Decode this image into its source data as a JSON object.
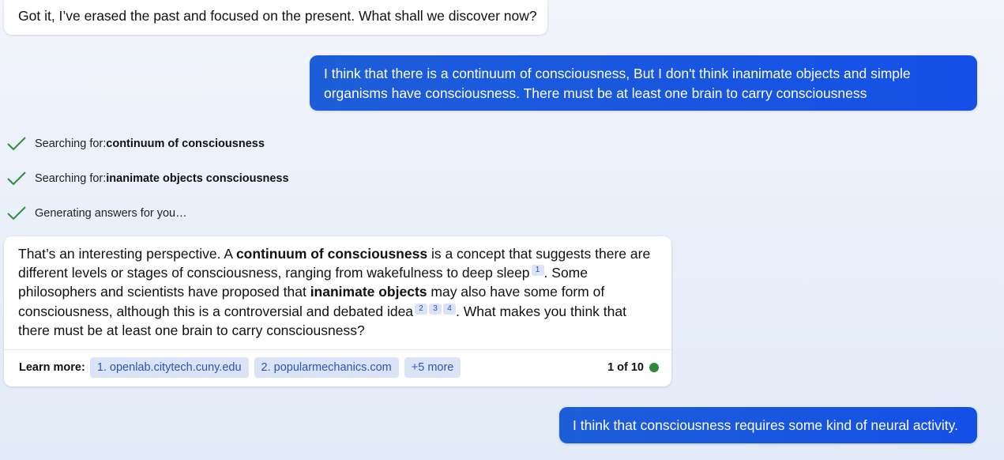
{
  "conversation": {
    "bot_message_1": "Got it, I’ve erased the past and focused on the present. What shall we discover now?",
    "user_message_1": "I think that there is a continuum of consciousness, But I don't think inanimate objects and simple organisms have consciousness. There must be at least one brain to carry consciousness",
    "status": [
      {
        "prefix": "Searching for: ",
        "query": "continuum of consciousness"
      },
      {
        "prefix": "Searching for: ",
        "query": "inanimate objects consciousness"
      },
      {
        "prefix": "Generating answers for you…",
        "query": ""
      }
    ],
    "bot_message_2": {
      "t1": "That’s an interesting perspective. A ",
      "b1": "continuum of consciousness",
      "t2": " is a concept that suggests there are different levels or stages of consciousness, ranging from wakefulness to deep sleep",
      "c1": "1",
      "t3": ". Some philosophers and scientists have proposed that ",
      "b2": "inanimate objects",
      "t4": " may also have some form of consciousness, although this is a controversial and debated idea",
      "c2": "2",
      "c3": "3",
      "c4": "4",
      "t5": ". What makes you think that there must be at least one brain to carry consciousness?"
    },
    "learn_more": {
      "label": "Learn more:",
      "links": [
        "1. openlab.citytech.cuny.edu",
        "2. popularmechanics.com"
      ],
      "more": "+5 more",
      "page_count": "1 of 10"
    },
    "user_message_2": "I think that consciousness requires some kind of neural activity."
  },
  "colors": {
    "user_bubble": "#1a55e0",
    "check": "#2e8b3a",
    "status_dot": "#2e8b3a",
    "chip_bg": "#dbe4f7",
    "chip_text": "#2c55b8"
  },
  "icons": {
    "status_check": "checkmark-icon",
    "page_status": "green-dot-icon"
  }
}
